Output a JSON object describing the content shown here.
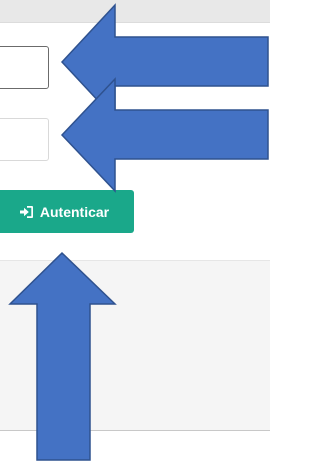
{
  "form": {
    "username_field": {
      "value": "",
      "placeholder": ""
    },
    "password_field": {
      "value": "",
      "placeholder": ""
    },
    "submit": {
      "label": "Autenticar",
      "icon": "sign-in-icon",
      "color": "#1aa88a"
    }
  },
  "annotations": {
    "arrow_color": "#4472c4",
    "arrow_outline": "#2f528f"
  }
}
